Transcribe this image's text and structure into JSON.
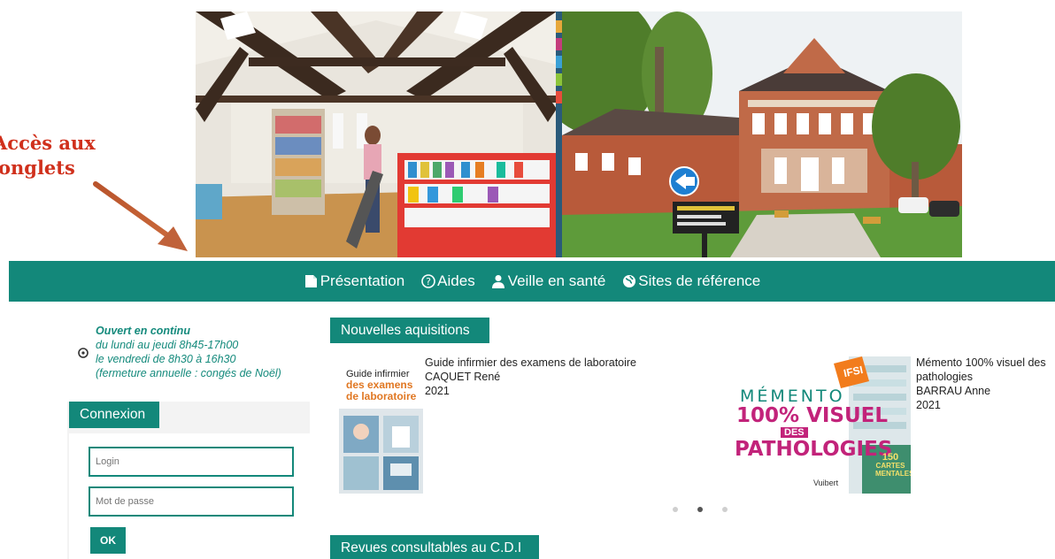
{
  "annotation": {
    "line1": "Accès aux",
    "line2": "onglets",
    "color": "#d0301c"
  },
  "nav": {
    "items": [
      {
        "label": "Présentation",
        "icon": "document-icon"
      },
      {
        "label": "Aides",
        "icon": "help-icon"
      },
      {
        "label": "Veille en santé",
        "icon": "users-icon"
      },
      {
        "label": "Sites de référence",
        "icon": "globe-icon"
      }
    ],
    "color": "#13887a"
  },
  "hours": {
    "title": "Ouvert en continu",
    "line1": "du lundi au jeudi 8h45-17h00",
    "line2": "le vendredi de 8h30 à 16h30",
    "line3": "(fermeture annuelle : congés de Noël)"
  },
  "login": {
    "tab": "Connexion",
    "login_placeholder": "Login",
    "password_placeholder": "Mot de passe",
    "ok_label": "OK"
  },
  "acquisitions": {
    "tab": "Nouvelles aquisitions",
    "books": [
      {
        "title": "Guide infirmier des examens de laboratoire",
        "author": "CAQUET René",
        "year": "2021",
        "cover_text": {
          "line1": "Guide infirmier",
          "line2": "des examens",
          "line3": "de laboratoire"
        }
      },
      {
        "title": "Mémento 100% visuel des pathologies",
        "author": "BARRAU Anne",
        "year": "2021",
        "cover_text": {
          "badge": "IFSI",
          "line1": "MÉMENTO",
          "line2": "100% VISUEL",
          "line3": "DES",
          "line4": "PATHOLOGIES",
          "publisher": "Vuibert",
          "badge2_line1": "150",
          "badge2_line2": "CARTES",
          "badge2_line3": "MENTALES"
        }
      }
    ],
    "dots_total": 3,
    "dots_active": 2
  },
  "revues": {
    "tab": "Revues consultables au C.D.I"
  }
}
